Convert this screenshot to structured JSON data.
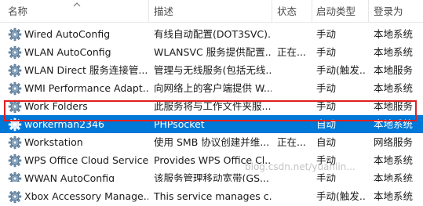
{
  "columns": {
    "name": "名称",
    "description": "描述",
    "status": "状态",
    "startup_type": "启动类型",
    "logon_as": "登录为"
  },
  "services": [
    {
      "name": "Wired AutoConfig",
      "description": "有线自动配置(DOT3SVC)...",
      "status": "",
      "startup_type": "手动",
      "logon_as": "本地系统"
    },
    {
      "name": "WLAN AutoConfig",
      "description": "WLANSVC 服务提供配置...",
      "status": "正在...",
      "startup_type": "手动",
      "logon_as": "本地系统"
    },
    {
      "name": "WLAN Direct 服务连接管...",
      "description": "管理与无线服务(包括无线...",
      "status": "",
      "startup_type": "手动(触发...",
      "logon_as": "本地服务"
    },
    {
      "name": "WMI Performance Adapt...",
      "description": "向网络上的客户端提供 W...",
      "status": "",
      "startup_type": "手动",
      "logon_as": "本地系统"
    },
    {
      "name": "Work Folders",
      "description": "此服务将与工作文件夹服...",
      "status": "",
      "startup_type": "手动",
      "logon_as": "本地服务"
    },
    {
      "name": "workerman2346",
      "description": "PHPsocket",
      "status": "",
      "startup_type": "自动",
      "logon_as": "本地系统"
    },
    {
      "name": "Workstation",
      "description": "使用 SMB 协议创建并维...",
      "status": "正在...",
      "startup_type": "自动",
      "logon_as": "网络服务"
    },
    {
      "name": "WPS Office Cloud Service",
      "description": "Provides WPS Office Cl...",
      "status": "",
      "startup_type": "手动",
      "logon_as": "本地系统"
    },
    {
      "name": "WWAN AutoConfig",
      "description": "该服务管理移动宽带(GS...",
      "status": "",
      "startup_type": "手动",
      "logon_as": "本地系统"
    },
    {
      "name": "Xbox Accessory Manage...",
      "description": "This service manages c...",
      "status": "",
      "startup_type": "手动(触发...",
      "logon_as": "本地系统"
    }
  ],
  "watermark": "blog.csdn.net/yuanlin...",
  "colors": {
    "selection": "#0078d7",
    "highlight_border": "#e02020"
  }
}
